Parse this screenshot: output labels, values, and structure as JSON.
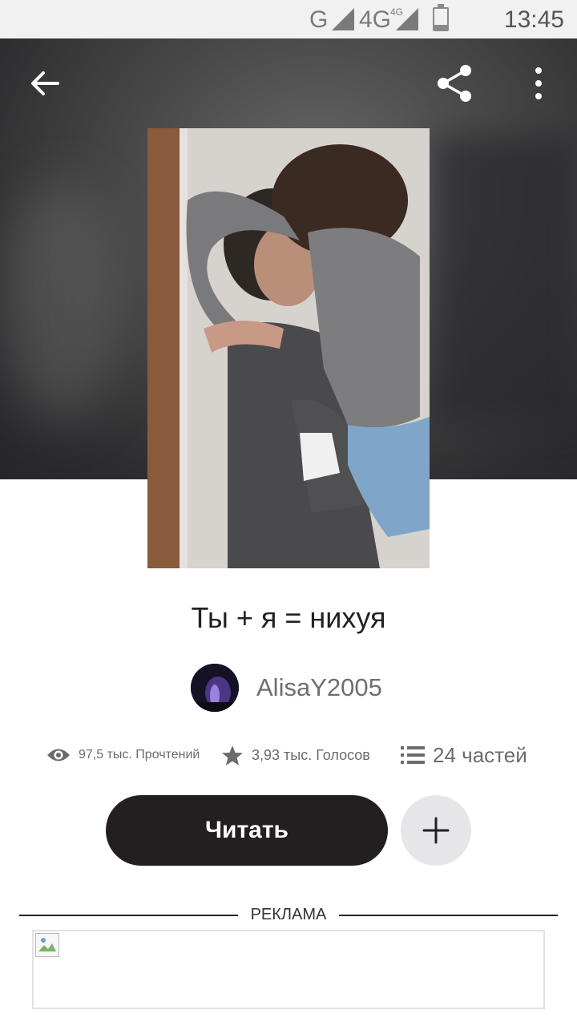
{
  "status_bar": {
    "network_g": "G",
    "network_4g": "4G",
    "network_4g_small": "4G",
    "battery_level": 0.25,
    "time": "13:45"
  },
  "toolbar": {
    "back_icon": "arrow-left-icon",
    "share_icon": "share-icon",
    "more_icon": "more-vertical-icon"
  },
  "story": {
    "title": "Ты + я = нихуя",
    "author": "AlisaY2005",
    "stats": {
      "reads": "97,5 тыс. Прочтений",
      "votes": "3,93 тыс. Голосов",
      "parts": "24 частей"
    },
    "read_label": "Читать",
    "add_icon": "plus-icon"
  },
  "ad": {
    "label": "РЕКЛАМА"
  },
  "colors": {
    "primary_button": "#231f20",
    "secondary_button": "#e6e6e8",
    "muted_text": "#6b6b6b"
  }
}
